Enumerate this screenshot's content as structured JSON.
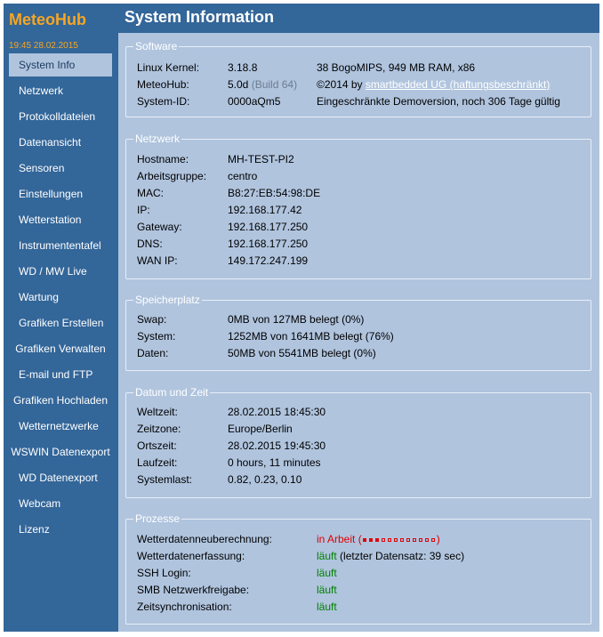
{
  "app": {
    "logo": "MeteoHub",
    "datetime": "19:45  28.02.2015"
  },
  "nav": [
    {
      "label": "System Info",
      "active": true
    },
    {
      "label": "Netzwerk"
    },
    {
      "label": "Protokolldateien"
    },
    {
      "label": "Datenansicht"
    },
    {
      "label": "Sensoren"
    },
    {
      "label": "Einstellungen"
    },
    {
      "label": "Wetterstation"
    },
    {
      "label": "Instrumententafel"
    },
    {
      "label": "WD / MW Live"
    },
    {
      "label": "Wartung"
    },
    {
      "label": "Grafiken Erstellen"
    },
    {
      "label": "Grafiken Verwalten"
    },
    {
      "label": "E-mail und FTP"
    },
    {
      "label": "Grafiken Hochladen"
    },
    {
      "label": "Wetternetzwerke"
    },
    {
      "label": "WSWIN Datenexport"
    },
    {
      "label": "WD Datenexport"
    },
    {
      "label": "Webcam"
    },
    {
      "label": "Lizenz"
    }
  ],
  "page_title": "System Information",
  "software": {
    "legend": "Software",
    "rows": [
      {
        "label": "Linux Kernel:",
        "value": "3.18.8",
        "extra": "38 BogoMIPS, 949 MB RAM, x86"
      },
      {
        "label": "MeteoHub:",
        "value": "5.0d",
        "build": "(Build 64)",
        "extra_prefix": "©2014 by",
        "extra_link": "smartbedded UG (haftungsbeschränkt)"
      },
      {
        "label": "System-ID:",
        "value": "0000aQm5",
        "extra": "Eingeschränkte Demoversion, noch 306 Tage gültig"
      }
    ]
  },
  "network": {
    "legend": "Netzwerk",
    "rows": [
      {
        "label": "Hostname:",
        "value": "MH-TEST-PI2"
      },
      {
        "label": "Arbeitsgruppe:",
        "value": "centro"
      },
      {
        "label": "MAC:",
        "value": "B8:27:EB:54:98:DE"
      },
      {
        "label": "IP:",
        "value": "192.168.177.42"
      },
      {
        "label": "Gateway:",
        "value": "192.168.177.250"
      },
      {
        "label": "DNS:",
        "value": "192.168.177.250"
      },
      {
        "label": "WAN IP:",
        "value": "149.172.247.199"
      }
    ]
  },
  "storage": {
    "legend": "Speicherplatz",
    "rows": [
      {
        "label": "Swap:",
        "value": "0MB von 127MB belegt (0%)"
      },
      {
        "label": "System:",
        "value": "1252MB von 1641MB belegt (76%)"
      },
      {
        "label": "Daten:",
        "value": "50MB von 5541MB belegt (0%)"
      }
    ]
  },
  "datetime_section": {
    "legend": "Datum und Zeit",
    "rows": [
      {
        "label": "Weltzeit:",
        "value": "28.02.2015 18:45:30"
      },
      {
        "label": "Zeitzone:",
        "value": "Europe/Berlin"
      },
      {
        "label": "Ortszeit:",
        "value": "28.02.2015 19:45:30"
      },
      {
        "label": "Laufzeit:",
        "value": "0 hours, 11 minutes"
      },
      {
        "label": "Systemlast:",
        "value": "0.82, 0.23, 0.10"
      }
    ]
  },
  "processes": {
    "legend": "Prozesse",
    "rows": [
      {
        "label": "Wetterdatenneuberechnung:",
        "status": "in Arbeit",
        "open": "(",
        "close": ")",
        "progress_filled": 3,
        "progress_total": 12,
        "color": "#e00000"
      },
      {
        "label": "Wetterdatenerfassung:",
        "status": "läuft",
        "note": "(letzter Datensatz: 39 sec)",
        "color": "#008000"
      },
      {
        "label": "SSH Login:",
        "status": "läuft",
        "color": "#008000"
      },
      {
        "label": "SMB Netzwerkfreigabe:",
        "status": "läuft",
        "color": "#008000"
      },
      {
        "label": "Zeitsynchronisation:",
        "status": "läuft",
        "color": "#008000"
      }
    ]
  },
  "colors": {
    "accent": "#f5a623",
    "sidebar": "#336699",
    "content": "#b0c4de",
    "running": "#008000",
    "busy": "#e00000"
  }
}
